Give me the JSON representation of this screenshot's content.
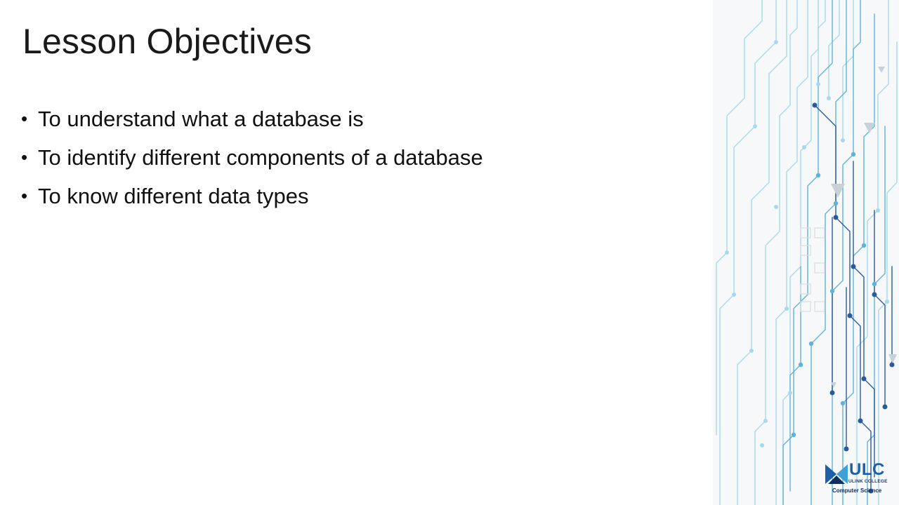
{
  "slide": {
    "title": "Lesson Objectives",
    "bullets": [
      "To understand  what a database is",
      "To identify different components of a database",
      "To know different  data types"
    ]
  },
  "logo": {
    "name": "ULC",
    "subtitle": "ULINK COLLEGE",
    "department": "Computer Science"
  },
  "colors": {
    "circuit_light": "#a9d8ec",
    "circuit_mid": "#5fb3d8",
    "circuit_dark": "#2a5a9a",
    "logo_blue": "#1f5fa8"
  }
}
